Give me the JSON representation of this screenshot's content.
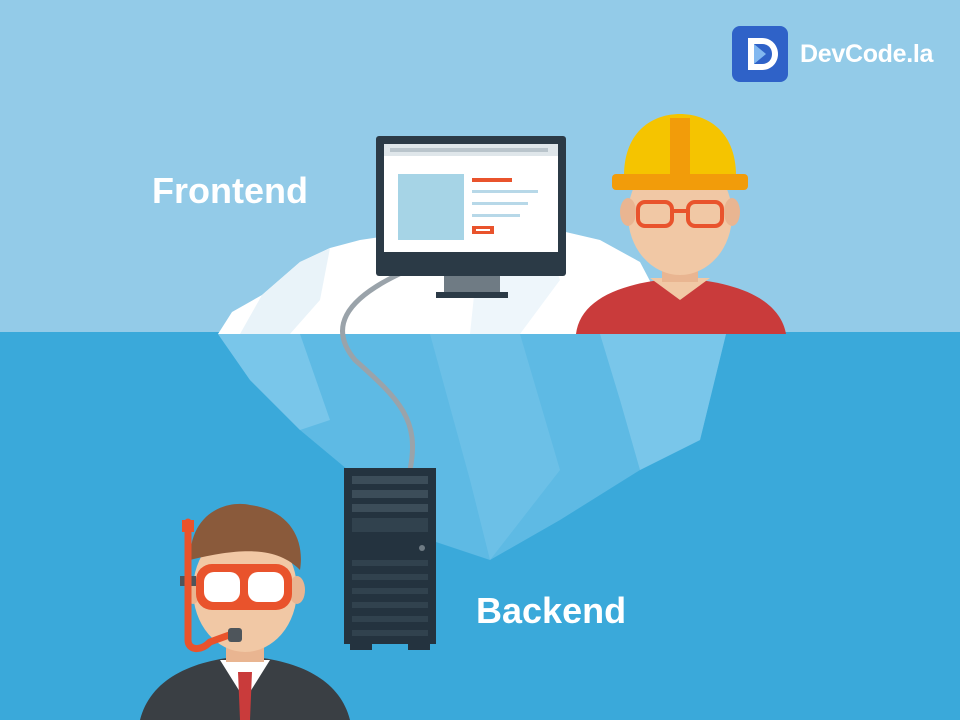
{
  "brand": {
    "name": "DevCode.la",
    "icon": "devcode-logo-icon"
  },
  "labels": {
    "frontend": "Frontend",
    "backend": "Backend"
  },
  "colors": {
    "sky": "#93cbe8",
    "sea": "#3aa9da",
    "iceberg": "#ffffff",
    "hard_hat": "#f5c400",
    "shirt": "#c93b3b",
    "goggles": "#e9532c",
    "server": "#24333f"
  }
}
